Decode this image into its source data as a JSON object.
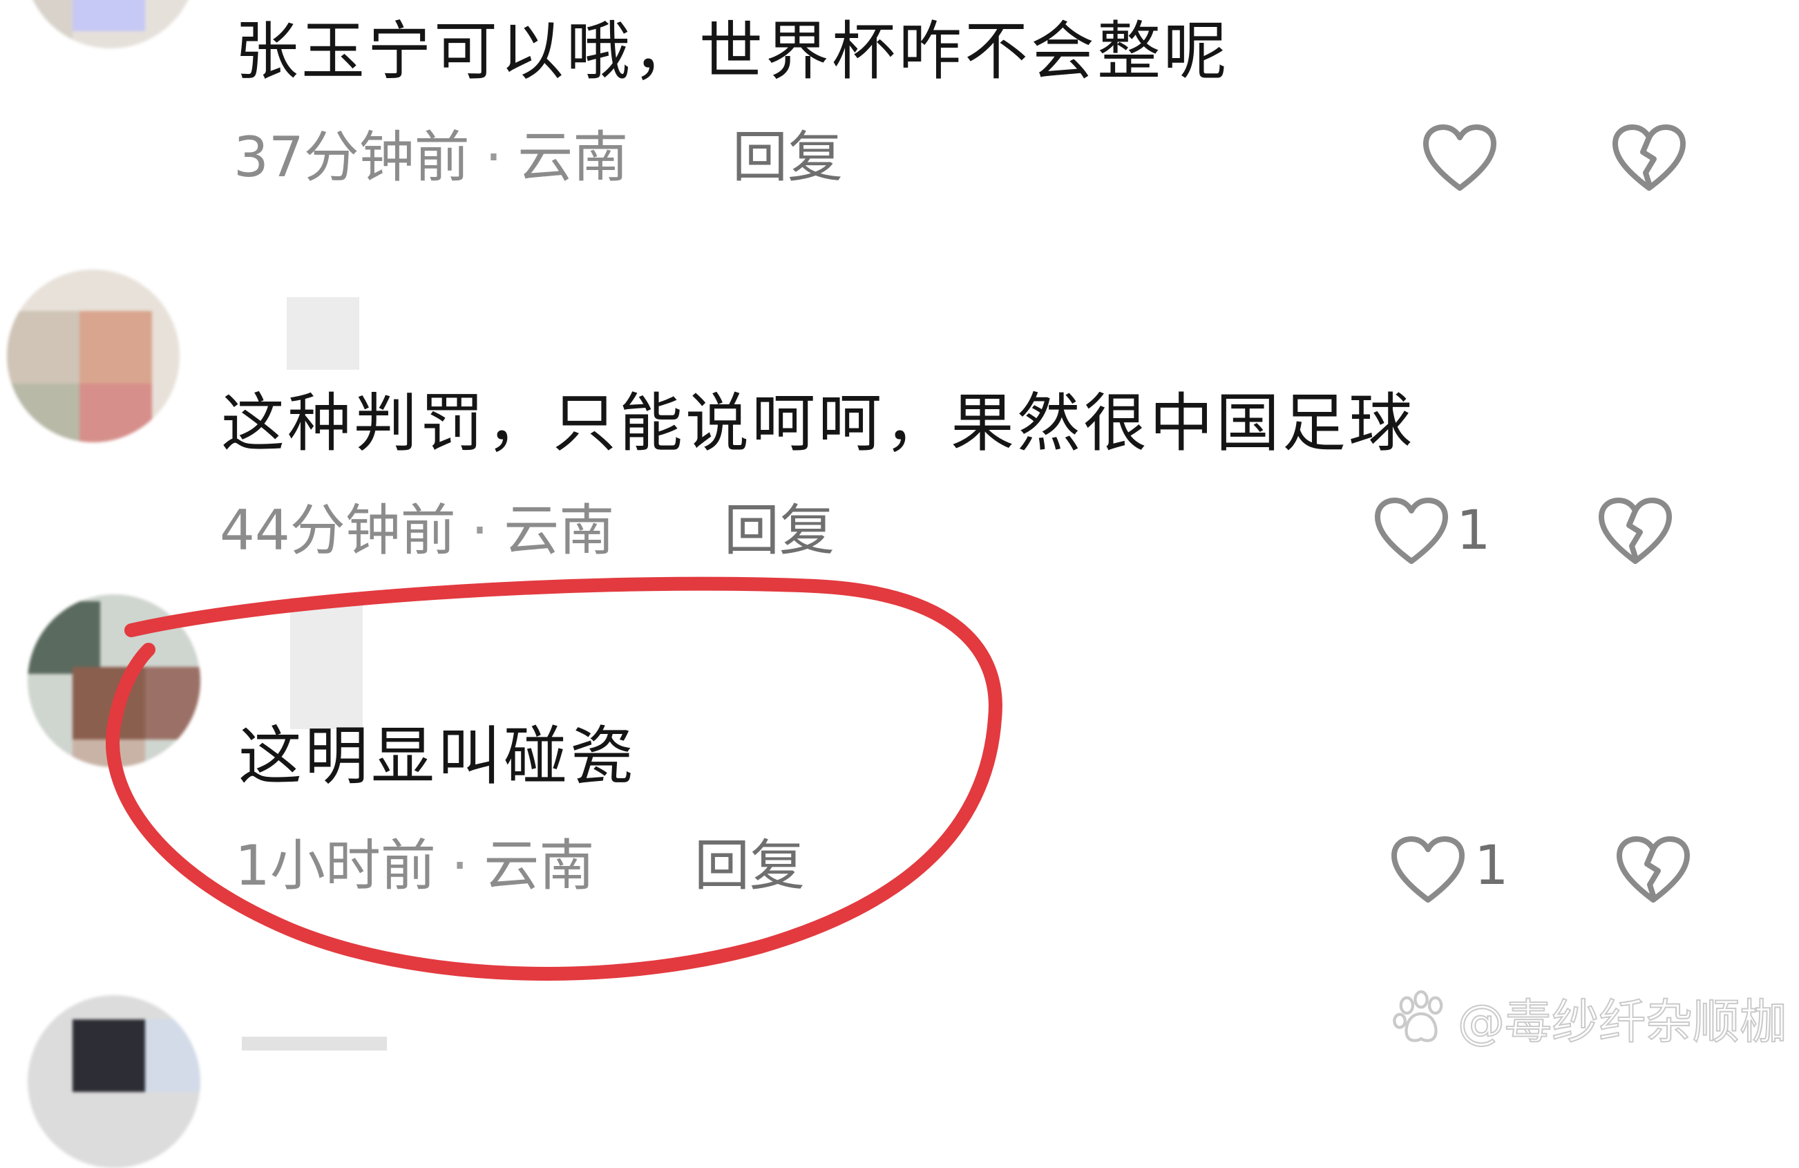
{
  "comments": [
    {
      "text": "张玉宁可以哦，世界杯咋不会整呢",
      "time": "37分钟前",
      "location": "云南",
      "reply_label": "回复",
      "likes": ""
    },
    {
      "text": "这种判罚，只能说呵呵，果然很中国足球",
      "time": "44分钟前",
      "location": "云南",
      "reply_label": "回复",
      "likes": "1"
    },
    {
      "text": "这明显叫碰瓷",
      "time": "1小时前",
      "location": "云南",
      "reply_label": "回复",
      "likes": "1"
    }
  ],
  "separator": "·",
  "watermark": "@毒纱纤杂顺枷",
  "colors": {
    "highlight_circle": "#e23a3f",
    "text": "#151515",
    "meta": "#8c8c8c",
    "icon": "#8a8a8a"
  },
  "icons": {
    "like": "heart-outline-icon",
    "dislike": "broken-heart-icon",
    "watermark_logo": "paw-icon"
  }
}
